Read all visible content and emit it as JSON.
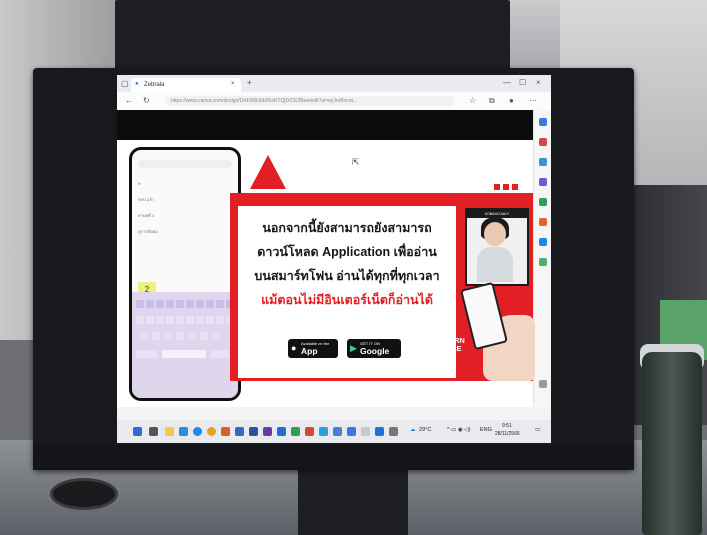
{
  "browser": {
    "tab_title": "Zebrala",
    "url": "https://www.canva.com/design/DAF0Nl/3d/A5cKTQjD/CE2Bee/edit?ui=eyJreBvcnt...",
    "new_tab_symbol": "+",
    "close_symbol": "×",
    "window_controls": [
      "—",
      "☐",
      "×"
    ]
  },
  "phone_mockup": {
    "search_rows": [
      "ค",
      "หลบ แล้ว",
      "ค่าบทที่ 4",
      "ดูการตัดต่อ"
    ],
    "highlighted_key": "2"
  },
  "banner": {
    "lines": [
      "นอกจากนี้ยังสามารถยังสามารถ",
      "ดาวน์โหลด Application เพื่ออ่าน",
      "บนสมาร์ทโฟน อ่านได้ทุกที่ทุกเวลา"
    ],
    "red_line": "แม้ตอนไม่มีอินเตอร์เน็ตก็อ่านได้",
    "app_store": {
      "small": "Available on the",
      "large": "App Store"
    },
    "google_play": {
      "small": "GET IT ON",
      "large": "Google play"
    },
    "video_label": "KOBAYA  DAILY",
    "learn_more": [
      "LEARN",
      "MORE"
    ],
    "accent_color": "#e31f26"
  },
  "taskbar": {
    "weather": "29°C",
    "language": "ENG",
    "time": "9:51",
    "date": "28/11/2566"
  }
}
